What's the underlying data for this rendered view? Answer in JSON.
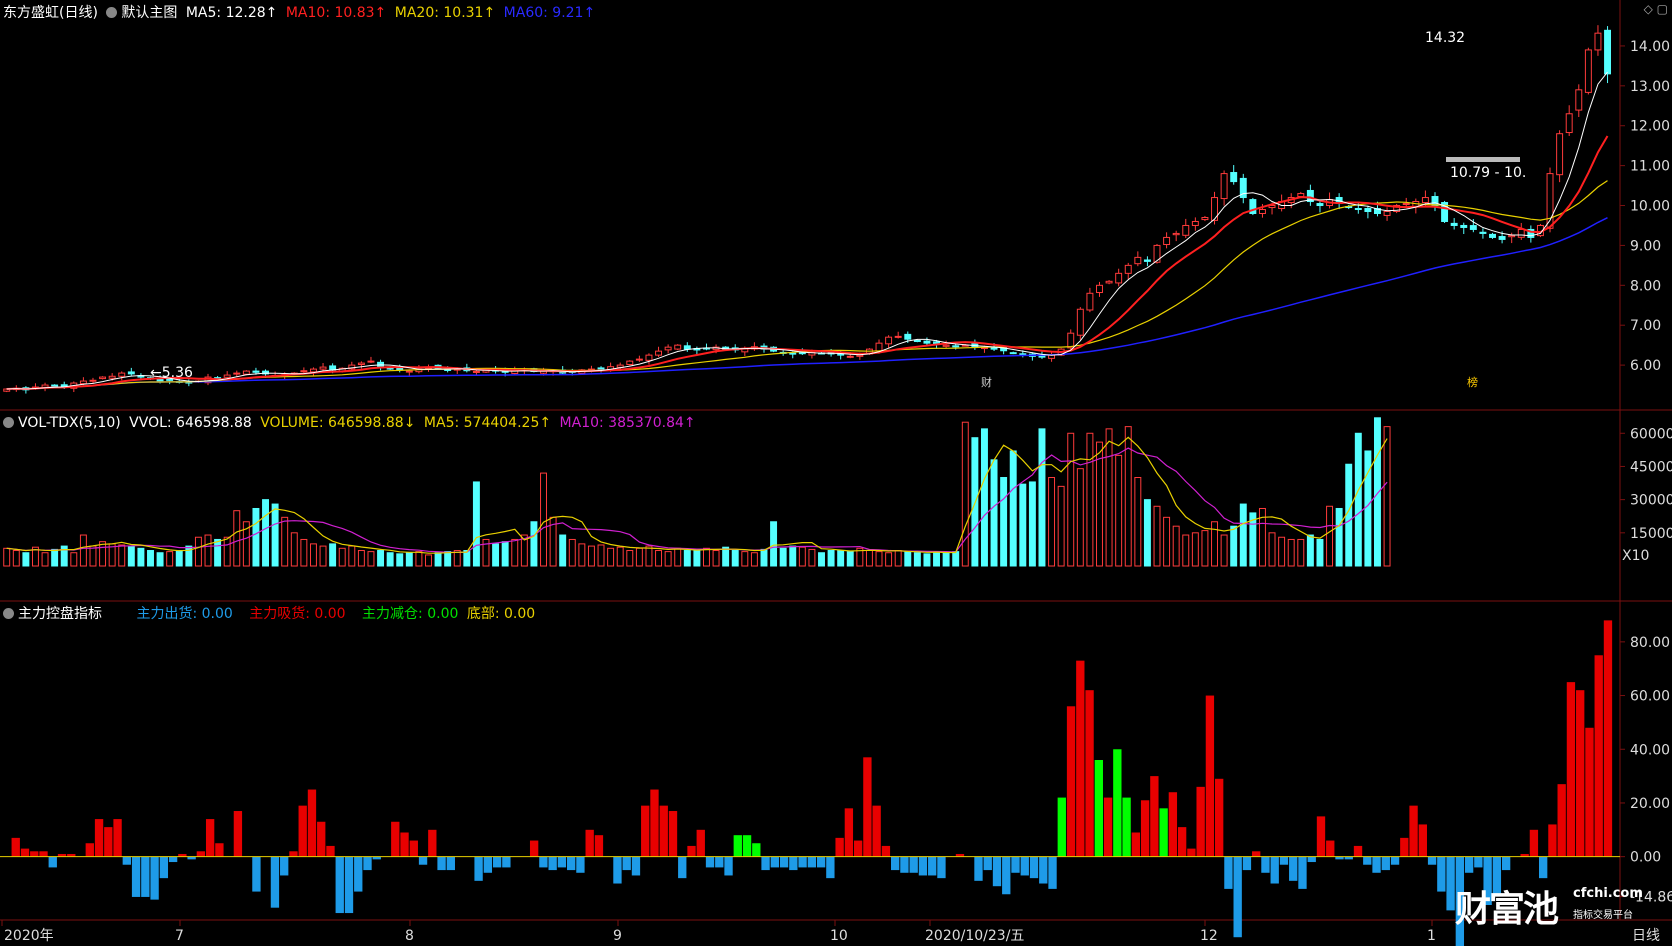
{
  "header": {
    "title": "东方盛虹(日线)",
    "template": "默认主图",
    "ma5": "MA5: 12.28↑",
    "ma10": "MA10: 10.83↑",
    "ma20": "MA20: 10.31↑",
    "ma60": "MA60: 9.21↑"
  },
  "vol_header": {
    "name": "VOL-TDX(5,10)",
    "vvol": "VVOL: 646598.88",
    "volume": "VOLUME: 646598.88↓",
    "ma5": "MA5: 574404.25↑",
    "ma10": "MA10: 385370.84↑"
  },
  "ind_header": {
    "name": "主力控盘指标",
    "out": "主力出货: 0.00",
    "absorb": "主力吸货: 0.00",
    "reduce": "主力减仓: 0.00",
    "bottom": "底部: 0.00"
  },
  "colors": {
    "up": "#ff3b3b",
    "down": "#54ffff",
    "ma5": "#ffffff",
    "ma10": "#ff2020",
    "ma20": "#e8d000",
    "ma60": "#2020ff",
    "vol_ma5": "#e8d000",
    "vol_ma10": "#d020d0",
    "ind_red": "#e80000",
    "ind_green": "#00ff00",
    "ind_blue": "#1e9be8",
    "axis_text": "#dddddd"
  },
  "chart_data": [
    {
      "type": "candlestick",
      "name": "price",
      "y_ticks": [
        "14.00",
        "13.00",
        "12.00",
        "11.00",
        "10.00",
        "9.00",
        "8.00",
        "7.00",
        "6.00"
      ],
      "ylim": [
        5.0,
        14.6
      ],
      "annotations": {
        "high_label": "14.32",
        "low_label": "←5.36",
        "price_box": "10.79 - 10.",
        "marker_fin": "财",
        "marker_bang": "榜"
      },
      "closes": [
        5.4,
        5.42,
        5.38,
        5.45,
        5.5,
        5.48,
        5.46,
        5.55,
        5.6,
        5.62,
        5.7,
        5.72,
        5.8,
        5.78,
        5.7,
        5.65,
        5.6,
        5.62,
        5.58,
        5.55,
        5.6,
        5.7,
        5.68,
        5.75,
        5.8,
        5.85,
        5.82,
        5.78,
        5.74,
        5.76,
        5.8,
        5.86,
        5.9,
        5.95,
        5.88,
        5.92,
        6.0,
        6.05,
        6.1,
        5.95,
        5.9,
        5.88,
        5.85,
        5.9,
        5.95,
        5.92,
        5.88,
        5.9,
        5.86,
        5.84,
        5.88,
        5.85,
        5.82,
        5.86,
        5.88,
        5.84,
        5.85,
        5.86,
        5.8,
        5.82,
        5.88,
        5.9,
        5.92,
        5.96,
        6.0,
        6.1,
        6.15,
        6.25,
        6.35,
        6.45,
        6.5,
        6.4,
        6.38,
        6.42,
        6.45,
        6.4,
        6.38,
        6.42,
        6.46,
        6.4,
        6.35,
        6.3,
        6.28,
        6.3,
        6.32,
        6.3,
        6.28,
        6.25,
        6.22,
        6.25,
        6.4,
        6.55,
        6.7,
        6.72,
        6.65,
        6.6,
        6.55,
        6.52,
        6.5,
        6.48,
        6.5,
        6.45,
        6.44,
        6.4,
        6.36,
        6.3,
        6.26,
        6.22,
        6.2,
        6.25,
        6.4,
        6.8,
        7.4,
        7.8,
        8.0,
        8.1,
        8.3,
        8.5,
        8.7,
        8.6,
        9.0,
        9.2,
        9.3,
        9.5,
        9.6,
        9.7,
        10.2,
        10.8,
        10.6,
        10.2,
        9.8,
        9.9,
        10.0,
        10.1,
        10.2,
        10.3,
        10.1,
        10.0,
        10.15,
        10.05,
        9.95,
        9.9,
        9.85,
        9.8,
        9.85,
        10.0,
        10.05,
        10.1,
        10.2,
        10.0,
        9.6,
        9.5,
        9.45,
        9.4,
        9.3,
        9.2,
        9.15,
        9.25,
        9.4,
        9.2,
        9.5,
        10.8,
        11.8,
        12.3,
        12.9,
        13.9,
        14.32,
        13.3
      ],
      "ma5_line": "computed",
      "ma10_line": "computed",
      "ma20_line": "computed",
      "ma60_line": "computed"
    },
    {
      "type": "bar",
      "name": "volume",
      "y_ticks": [
        "60000",
        "45000",
        "30000",
        "15000"
      ],
      "unit": "X10",
      "ylim": [
        0,
        66000
      ],
      "values": [
        8000,
        7000,
        6000,
        8500,
        6000,
        7500,
        9000,
        6000,
        14000,
        9000,
        11000,
        10000,
        9500,
        9000,
        8000,
        7000,
        6000,
        6500,
        7000,
        9000,
        13000,
        14000,
        12000,
        13000,
        25000,
        20000,
        26000,
        30000,
        28000,
        22000,
        15000,
        12000,
        10000,
        9000,
        10000,
        8000,
        9000,
        7000,
        6500,
        7000,
        6000,
        5500,
        6000,
        6500,
        5000,
        6000,
        6500,
        7000,
        7000,
        38000,
        12000,
        10000,
        11000,
        12000,
        14000,
        20000,
        42000,
        22000,
        14000,
        12000,
        10000,
        9000,
        9500,
        8000,
        8500,
        7000,
        8000,
        9000,
        7000,
        6500,
        8000,
        7000,
        7500,
        8000,
        7000,
        8500,
        7000,
        6500,
        6000,
        7500,
        20000,
        8000,
        9000,
        8500,
        7500,
        6000,
        7000,
        7000,
        6500,
        8000,
        7000,
        6500,
        6000,
        7000,
        6500,
        6000,
        5500,
        6500,
        6000,
        6500,
        65000,
        58000,
        62000,
        48000,
        40000,
        52000,
        37000,
        38000,
        62000,
        40000,
        36000,
        60000,
        44000,
        60000,
        56000,
        62000,
        50000,
        63000,
        40000,
        30000,
        27000,
        22000,
        18000,
        14000,
        15000,
        16000,
        20000,
        14000,
        18000,
        28000,
        24000,
        26000,
        15000,
        13000,
        12000,
        12000,
        14000,
        12000,
        27000,
        26000,
        46000,
        60000,
        52000,
        67000,
        63000
      ],
      "ma5_line": "computed",
      "ma10_line": "computed"
    },
    {
      "type": "bar",
      "name": "主力控盘指标",
      "y_ticks": [
        "80.00",
        "60.00",
        "40.00",
        "20.00",
        "0.00",
        "-14.86"
      ],
      "ylim": [
        -18,
        90
      ],
      "values": [
        0,
        7,
        3,
        2,
        2,
        -4,
        1,
        1,
        0,
        5,
        14,
        11,
        14,
        -3,
        -15,
        -15,
        -16,
        -8,
        -2,
        1,
        -1,
        2,
        14,
        5,
        0,
        17,
        0,
        -13,
        0,
        -19,
        -7,
        2,
        19,
        25,
        13,
        4,
        -21,
        -21,
        -13,
        -5,
        -1,
        0,
        13,
        9,
        6,
        -3,
        10,
        -5,
        -5,
        0,
        0,
        -9,
        -6,
        -4,
        -4,
        0,
        0,
        6,
        -4,
        -5,
        -4,
        -5,
        -6,
        10,
        8,
        0,
        -10,
        -5,
        -7,
        19,
        25,
        19,
        17,
        -8,
        4,
        10,
        -4,
        -4,
        -7,
        8,
        8,
        5,
        -5,
        -4,
        -4,
        -5,
        -4,
        -4,
        -4,
        -8,
        7,
        18,
        6,
        37,
        19,
        4,
        -5,
        -6,
        -6,
        -7,
        -7,
        -8,
        0,
        1,
        0,
        -9,
        -5,
        -11,
        -14,
        -6,
        -7,
        -8,
        -10,
        -12,
        22,
        56,
        73,
        62,
        36,
        22,
        40,
        22,
        9,
        21,
        30,
        18,
        24,
        11,
        3,
        26,
        60,
        29,
        -12,
        -30,
        -5,
        2,
        -6,
        -10,
        -3,
        -9,
        -12,
        -2,
        15,
        6,
        -1,
        -1,
        4,
        -3,
        -6,
        -5,
        -3,
        7,
        19,
        12,
        -3,
        -13,
        -20,
        -34,
        -6,
        -4,
        -18,
        -14,
        -5,
        0,
        1,
        10,
        -8,
        12,
        27,
        65,
        62,
        48,
        75,
        88
      ]
    }
  ],
  "x_axis": {
    "labels": [
      "2020年",
      "7",
      "8",
      "9",
      "10",
      "2020/10/23/五",
      "12",
      "1"
    ],
    "period": "日线"
  },
  "watermark": {
    "brand": "财富池",
    "site": "cfchi.com",
    "subtitle": "指标交易平台"
  }
}
